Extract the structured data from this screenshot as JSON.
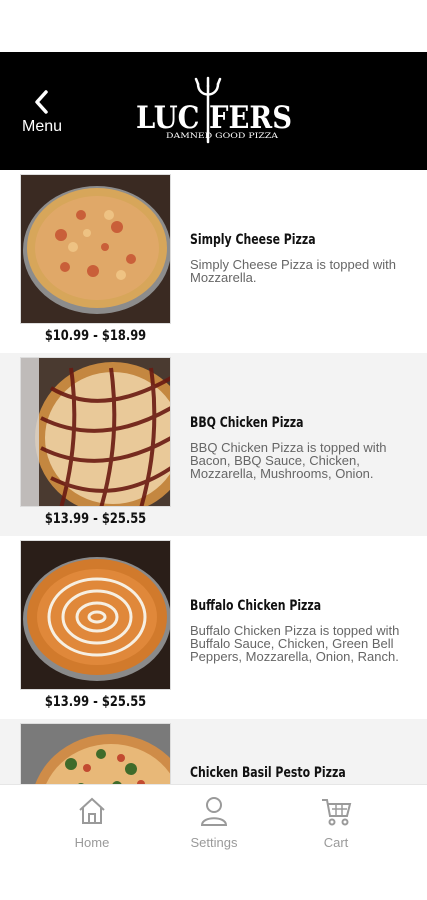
{
  "header": {
    "back_label": "Menu",
    "logo_text": "LUCIFERS",
    "logo_tagline": "DAMNED GOOD PIZZA"
  },
  "items": [
    {
      "name": "Simply Cheese Pizza",
      "description": "Simply Cheese Pizza is topped with Mozzarella.",
      "price": "$10.99 - $18.99",
      "image": "cheese-pizza-photo"
    },
    {
      "name": "BBQ Chicken Pizza",
      "description": "BBQ Chicken Pizza is topped with Bacon, BBQ Sauce, Chicken, Mozzarella, Mushrooms, Onion.",
      "price": "$13.99 - $25.55",
      "image": "bbq-chicken-pizza-photo"
    },
    {
      "name": "Buffalo Chicken Pizza",
      "description": "Buffalo Chicken Pizza is topped with Buffalo Sauce, Chicken, Green Bell Peppers, Mozzarella, Onion, Ranch.",
      "price": "$13.99 - $25.55",
      "image": "buffalo-chicken-pizza-photo"
    },
    {
      "name": "Chicken Basil Pesto Pizza",
      "description": "",
      "price": "",
      "image": "chicken-basil-pesto-pizza-photo"
    }
  ],
  "tabbar": {
    "home_label": "Home",
    "settings_label": "Settings",
    "cart_label": "Cart",
    "home_icon": "home-icon",
    "settings_icon": "user-icon",
    "cart_icon": "cart-icon"
  },
  "colors": {
    "header_bg": "#000000",
    "alt_row_bg": "#f3f3f3",
    "tab_text": "#9a9a9a"
  }
}
